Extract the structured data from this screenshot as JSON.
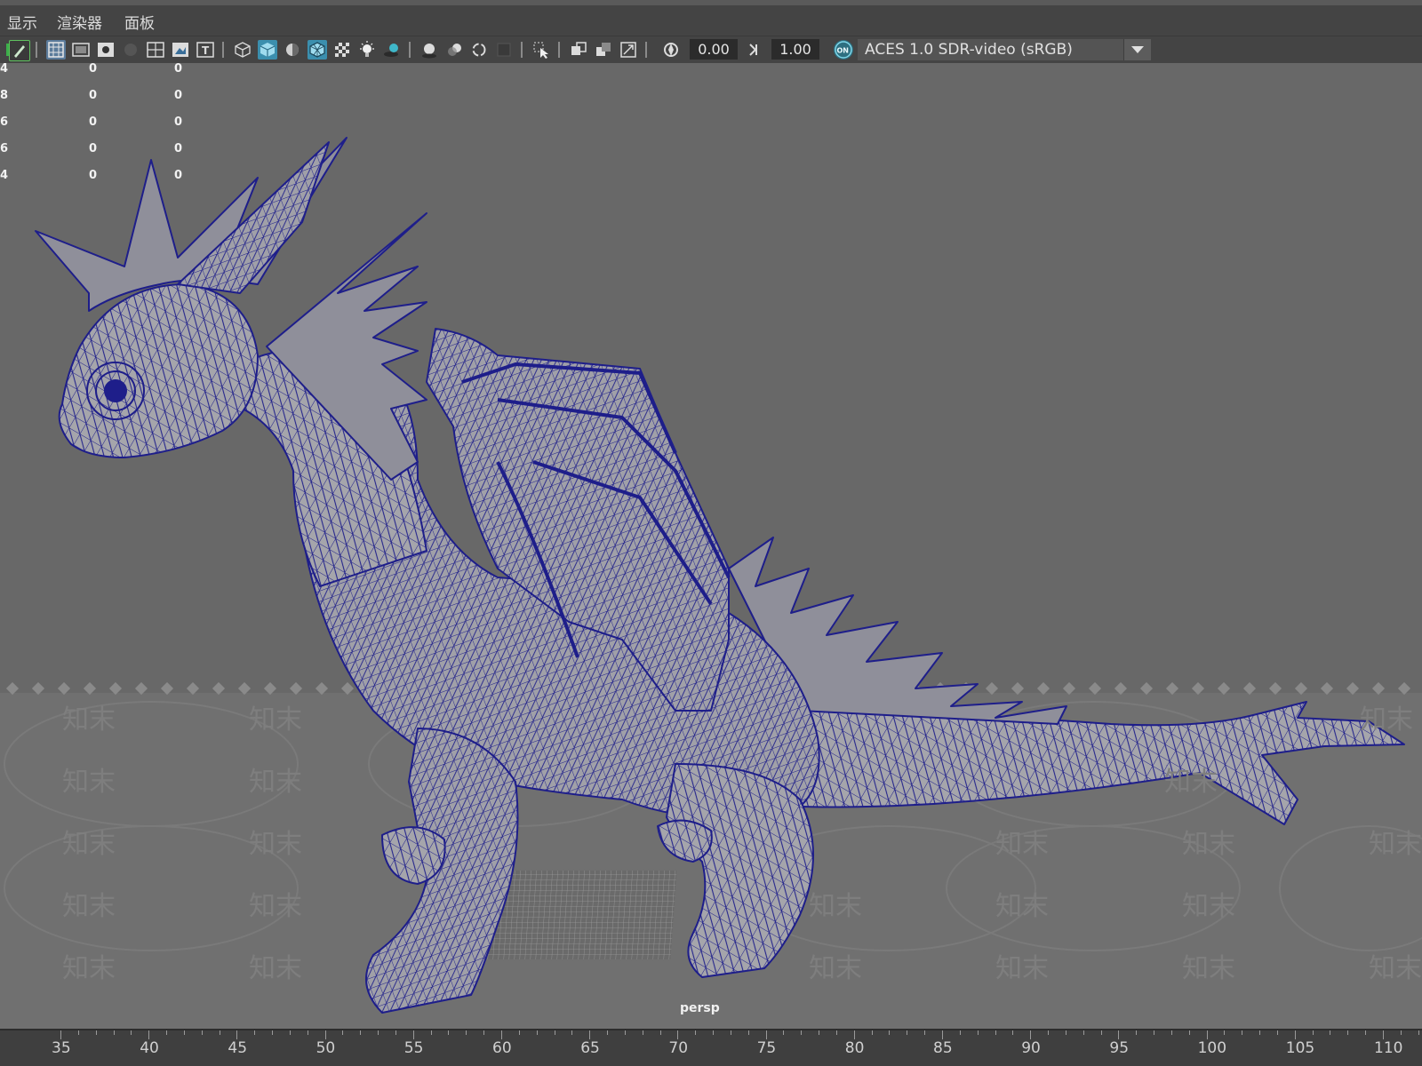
{
  "menu": [
    "显示",
    "渲染器",
    "面板"
  ],
  "toolbar": {
    "icons": [
      "key-icon",
      "pencil-icon",
      "grid-icon",
      "film-gate-icon",
      "resolution-gate-icon",
      "circle-icon",
      "field-chart-icon",
      "safe-action-icon",
      "safe-title-icon",
      "wireframe-cube-icon",
      "shaded-cube-icon",
      "smooth-shade-icon",
      "wireframe-on-shaded-icon",
      "xray-icon",
      "lights-icon",
      "shadows-icon",
      "ambient-occlusion-icon",
      "motion-blur-icon",
      "anti-alias-icon",
      "depth-of-field-icon",
      "isolate-select-icon",
      "xray-joints-icon",
      "xray-active-icon",
      "backface-icon",
      "exposure-icon",
      "gamma-icon",
      "color-management-icon"
    ],
    "exposure": "0.00",
    "gamma": "1.00",
    "cm_badge": "ON",
    "color_space": "ACES 1.0 SDR-video (sRGB)"
  },
  "hud": {
    "rows": [
      [
        "4",
        "0",
        "0"
      ],
      [
        "8",
        "0",
        "0"
      ],
      [
        "6",
        "0",
        "0"
      ],
      [
        "6",
        "0",
        "0"
      ],
      [
        "4",
        "0",
        "0"
      ]
    ]
  },
  "viewport": {
    "camera": "persp",
    "wire_color": "#1e1e8a",
    "background": "#686868",
    "watermark": "知末"
  },
  "timeline": {
    "ticks": [
      "35",
      "40",
      "45",
      "50",
      "55",
      "60",
      "65",
      "70",
      "75",
      "80",
      "85",
      "90",
      "95",
      "100",
      "105",
      "110"
    ]
  }
}
